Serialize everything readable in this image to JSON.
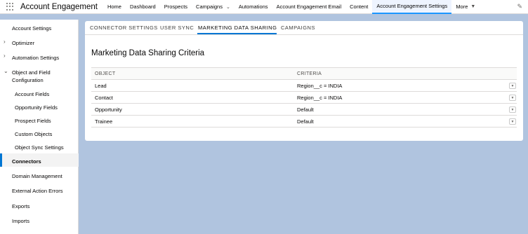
{
  "header": {
    "app_name": "Account Engagement",
    "nav": [
      {
        "label": "Home"
      },
      {
        "label": "Dashboard"
      },
      {
        "label": "Prospects"
      },
      {
        "label": "Campaigns"
      },
      {
        "label": "Automations"
      },
      {
        "label": "Account Engagement Email"
      },
      {
        "label": "Content"
      },
      {
        "label": "Account Engagement Settings"
      },
      {
        "label": "More"
      }
    ]
  },
  "sidebar": {
    "items": [
      {
        "label": "Account Settings"
      },
      {
        "label": "Optimizer"
      },
      {
        "label": "Automation Settings"
      },
      {
        "label": "Object and Field"
      },
      {
        "label": "Configuration"
      },
      {
        "label": "Account Fields"
      },
      {
        "label": "Opportunity Fields"
      },
      {
        "label": "Prospect Fields"
      },
      {
        "label": "Custom Objects"
      },
      {
        "label": "Object Sync Settings"
      },
      {
        "label": "Connectors"
      },
      {
        "label": "Domain Management"
      },
      {
        "label": "External Action Errors"
      },
      {
        "label": "Exports"
      },
      {
        "label": "Imports"
      }
    ]
  },
  "main": {
    "tabs": [
      {
        "label": "CONNECTOR SETTINGS"
      },
      {
        "label": "USER SYNC"
      },
      {
        "label": "MARKETING DATA SHARING"
      },
      {
        "label": "CAMPAIGNS"
      }
    ],
    "title": "Marketing Data Sharing Criteria",
    "table": {
      "headers": [
        "OBJECT",
        "CRITERIA"
      ],
      "rows": [
        {
          "object": "Lead",
          "criteria": "Region__c = INDIA"
        },
        {
          "object": "Contact",
          "criteria": "Region__c = INDIA"
        },
        {
          "object": "Opportunity",
          "criteria": "Default"
        },
        {
          "object": "Trainee",
          "criteria": "Default"
        }
      ]
    }
  },
  "colors": {
    "accent": "#0176d3",
    "background": "#b0c4df"
  }
}
